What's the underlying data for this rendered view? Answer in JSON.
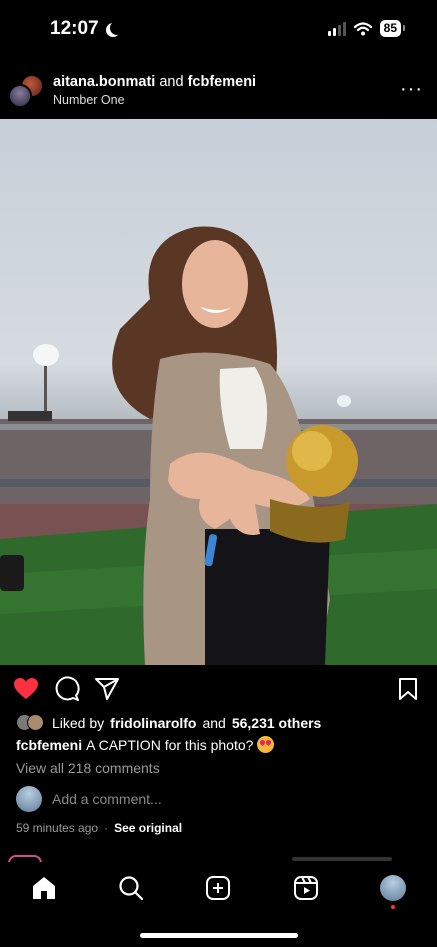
{
  "status_bar": {
    "time": "12:07",
    "battery": "85"
  },
  "post": {
    "author1": "aitana.bonmati",
    "connector": "and",
    "author2": "fcbfemeni",
    "subtitle": "Number One",
    "liked_prefix": "Liked by",
    "liked_user": "fridolinarolfo",
    "liked_and": "and",
    "liked_others": "56,231 others",
    "caption_user": "fcbfemeni",
    "caption_text": "A CAPTION for this photo?",
    "view_comments": "View all 218 comments",
    "add_comment_placeholder": "Add a comment...",
    "time_ago": "59 minutes ago",
    "separator": "·",
    "see_original": "See original",
    "liked": true
  },
  "colors": {
    "like": "#ff3040",
    "accent_story": "#d24d8c"
  },
  "icons": {
    "actions": [
      "heart-icon",
      "comment-icon",
      "share-icon",
      "bookmark-icon"
    ],
    "nav": [
      "home-icon",
      "search-icon",
      "create-icon",
      "reels-icon",
      "profile-avatar"
    ]
  }
}
